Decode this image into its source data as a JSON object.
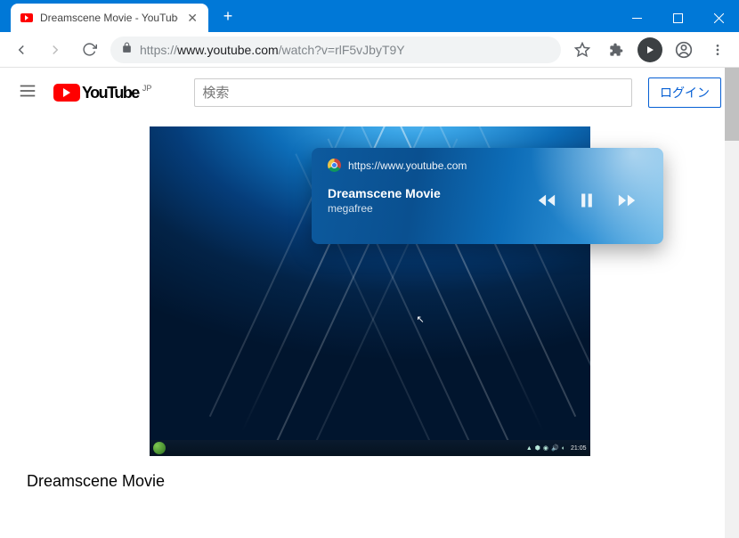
{
  "window": {
    "tab_title": "Dreamscene Movie - YouTube"
  },
  "addressbar": {
    "protocol": "https://",
    "host": "www.youtube.com",
    "path": "/watch?v=rlF5vJbyT9Y"
  },
  "youtube": {
    "brand": "YouTube",
    "region": "JP",
    "search_placeholder": "検索",
    "login_label": "ログイン"
  },
  "video": {
    "title": "Dreamscene Movie",
    "taskbar_clock": "21:05"
  },
  "media_popup": {
    "origin": "https://www.youtube.com",
    "title": "Dreamscene Movie",
    "artist": "megafree"
  }
}
